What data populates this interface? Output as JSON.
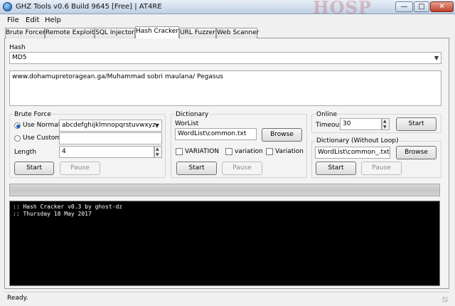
{
  "window": {
    "title": "GHZ Tools v0.6 Build 9645 [Free] | AT4RE",
    "minimize_glyph": "—",
    "maximize_glyph": "□",
    "close_glyph": "✕",
    "app_icon": "globe-icon",
    "watermark_text": "HOSP"
  },
  "menu": {
    "items": [
      "File",
      "Edit",
      "Help"
    ]
  },
  "tabs": [
    "Brute Forcer",
    "Remote Exploits",
    "SQL Injector",
    "Hash Cracker",
    "URL Fuzzer",
    "Web Scanner"
  ],
  "active_tab": "Hash Cracker",
  "hash": {
    "label": "Hash",
    "type_selected": "MD5",
    "input_value": "www.dohamupretoragean.ga/Muhammad sobri maulana/ Pegasus"
  },
  "brute_force": {
    "title": "Brute Force",
    "use_normal_label": "Use Normal",
    "use_normal_checked": true,
    "charset_selected": "abcdefghijklmnopqrstuvwxyz",
    "use_custom_label": "Use Custom",
    "custom_value": "",
    "length_label": "Length",
    "length_value": "4",
    "start_label": "Start",
    "pause_label": "Pause"
  },
  "dictionary": {
    "title": "Dictionary",
    "wordlist_label": "WorList",
    "wordlist_value": "WordList\\common.txt",
    "browse_label": "Browse",
    "variation_upper_label": "VARIATION",
    "variation_lower_label": "variation",
    "variation_title_label": "Variation",
    "start_label": "Start",
    "pause_label": "Pause"
  },
  "online": {
    "title": "Online",
    "timeout_label": "Timeout",
    "timeout_value": "30",
    "start_label": "Start"
  },
  "dictionary_no_loop": {
    "title": "Dictionary (Without Loop)",
    "wordlist_value": "WordList\\common_.txt",
    "browse_label": "Browse",
    "start_label": "Start",
    "pause_label": "Pause"
  },
  "progress": {
    "value": 0
  },
  "console": {
    "lines": [
      ":: Hash Cracker v0.3  by ghost-dz",
      ":: Thursday 18 May 2017"
    ]
  },
  "status": {
    "text": "Ready."
  },
  "colors": {
    "console_bg": "#000000",
    "console_fg": "#ffffff",
    "radio_accent": "#1d5fc0"
  }
}
